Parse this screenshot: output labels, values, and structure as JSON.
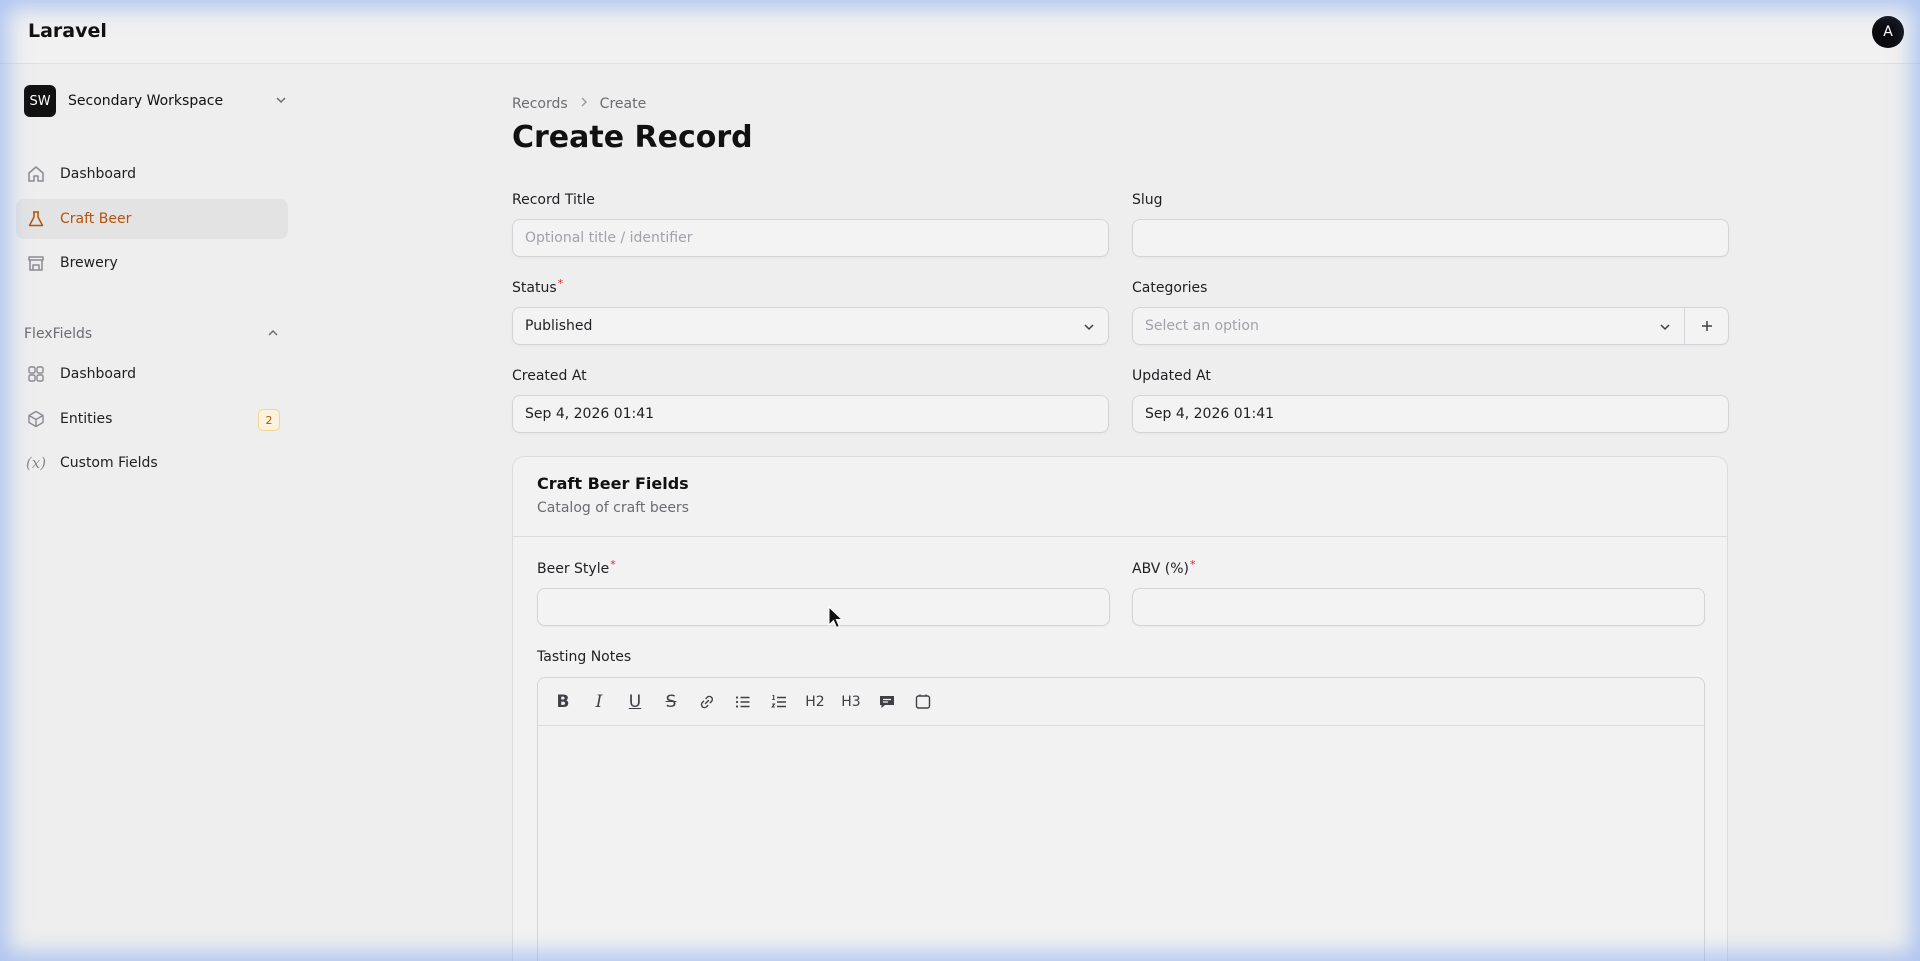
{
  "app": {
    "brand": "Laravel",
    "user_initial": "A"
  },
  "workspace": {
    "initials": "SW",
    "name": "Secondary Workspace"
  },
  "sidebar": {
    "items": [
      {
        "label": "Dashboard",
        "icon": "home-icon"
      },
      {
        "label": "Craft Beer",
        "icon": "flask-icon",
        "active": true
      },
      {
        "label": "Brewery",
        "icon": "building-icon"
      }
    ],
    "group": {
      "label": "FlexFields",
      "items": [
        {
          "label": "Dashboard",
          "icon": "grid-icon"
        },
        {
          "label": "Entities",
          "icon": "cube-icon",
          "badge": "2"
        },
        {
          "label": "Custom Fields",
          "icon": "variable-icon"
        }
      ]
    }
  },
  "breadcrumb": {
    "parent": "Records",
    "current": "Create"
  },
  "page": {
    "title": "Create Record"
  },
  "form": {
    "record_title": {
      "label": "Record Title",
      "placeholder": "Optional title / identifier",
      "value": ""
    },
    "slug": {
      "label": "Slug",
      "value": ""
    },
    "status": {
      "label": "Status",
      "value": "Published"
    },
    "categories": {
      "label": "Categories",
      "placeholder": "Select an option"
    },
    "created_at": {
      "label": "Created At",
      "value": "Sep 4, 2026 01:41"
    },
    "updated_at": {
      "label": "Updated At",
      "value": "Sep 4, 2026 01:41"
    }
  },
  "section": {
    "title": "Craft Beer Fields",
    "subtitle": "Catalog of craft beers",
    "beer_style": {
      "label": "Beer Style",
      "value": ""
    },
    "abv": {
      "label": "ABV (%)",
      "value": ""
    },
    "tasting_notes": {
      "label": "Tasting Notes",
      "toolbar": [
        {
          "name": "bold-icon",
          "glyph": "B"
        },
        {
          "name": "italic-icon",
          "glyph": "I"
        },
        {
          "name": "underline-icon",
          "glyph": "U"
        },
        {
          "name": "strikethrough-icon",
          "glyph": "S"
        },
        {
          "name": "link-icon",
          "glyph": ""
        },
        {
          "name": "bullet-list-icon",
          "glyph": ""
        },
        {
          "name": "ordered-list-icon",
          "glyph": ""
        },
        {
          "name": "heading-2-icon",
          "glyph": "H2"
        },
        {
          "name": "heading-3-icon",
          "glyph": "H3"
        },
        {
          "name": "blockquote-icon",
          "glyph": ""
        },
        {
          "name": "code-block-icon",
          "glyph": ""
        }
      ]
    }
  }
}
